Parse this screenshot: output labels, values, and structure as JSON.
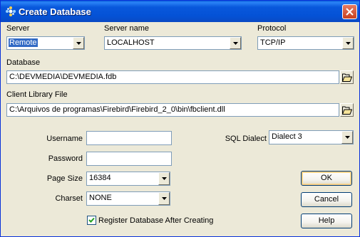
{
  "window": {
    "title": "Create Database"
  },
  "server": {
    "label": "Server",
    "value": "Remote",
    "server_name_label": "Server name",
    "server_name_value": "LOCALHOST",
    "protocol_label": "Protocol",
    "protocol_value": "TCP/IP"
  },
  "database": {
    "label": "Database",
    "value": "C:\\DEVMEDIA\\DEVMEDIA.fdb"
  },
  "client_library": {
    "label": "Client Library File",
    "value": "C:\\Arquivos de programas\\Firebird\\Firebird_2_0\\bin\\fbclient.dll"
  },
  "form": {
    "username_label": "Username",
    "username_value": "",
    "password_label": "Password",
    "password_value": "",
    "page_size_label": "Page Size",
    "page_size_value": "16384",
    "charset_label": "Charset",
    "charset_value": "NONE",
    "sql_dialect_label": "SQL Dialect",
    "sql_dialect_value": "Dialect 3",
    "register_label": "Register Database After Creating",
    "register_checked": true
  },
  "buttons": {
    "ok": "OK",
    "cancel": "Cancel",
    "help": "Help"
  },
  "icons": {
    "app": "firebird-app-icon",
    "close": "close-icon",
    "dropdown": "chevron-down-icon",
    "browse": "folder-open-icon",
    "check": "check-icon"
  },
  "colors": {
    "titlebar": "#0452d6",
    "close": "#c9411f",
    "selection": "#316ac5",
    "window_bg": "#ece9d8"
  }
}
